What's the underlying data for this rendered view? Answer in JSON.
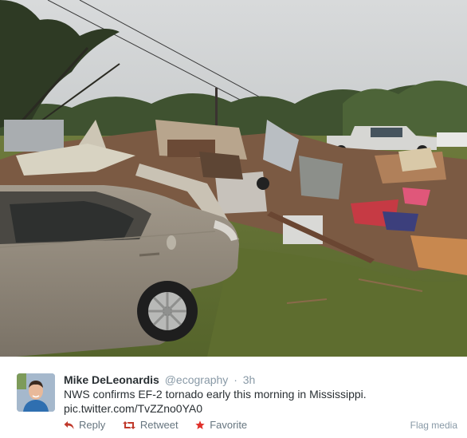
{
  "tweet": {
    "author_name": "Mike DeLeonardis",
    "handle": "@ecography",
    "separator": "·",
    "time": "3h",
    "text_line1": "NWS confirms EF-2 tornado early this morning in Mississippi.",
    "text_line2": "pic.twitter.com/TvZZno0YA0"
  },
  "actions": {
    "reply_label": "Reply",
    "retweet_label": "Retweet",
    "favorite_label": "Favorite",
    "flag_label": "Flag media"
  },
  "icons": {
    "reply": "reply-arrow-icon",
    "retweet": "retweet-icon",
    "favorite": "favorite-star-icon"
  },
  "colors": {
    "reply_icon": "#c0392b",
    "retweet_icon": "#c0392b",
    "favorite_icon": "#e0302a",
    "action_text": "#66757f",
    "meta_text": "#8899a6"
  }
}
